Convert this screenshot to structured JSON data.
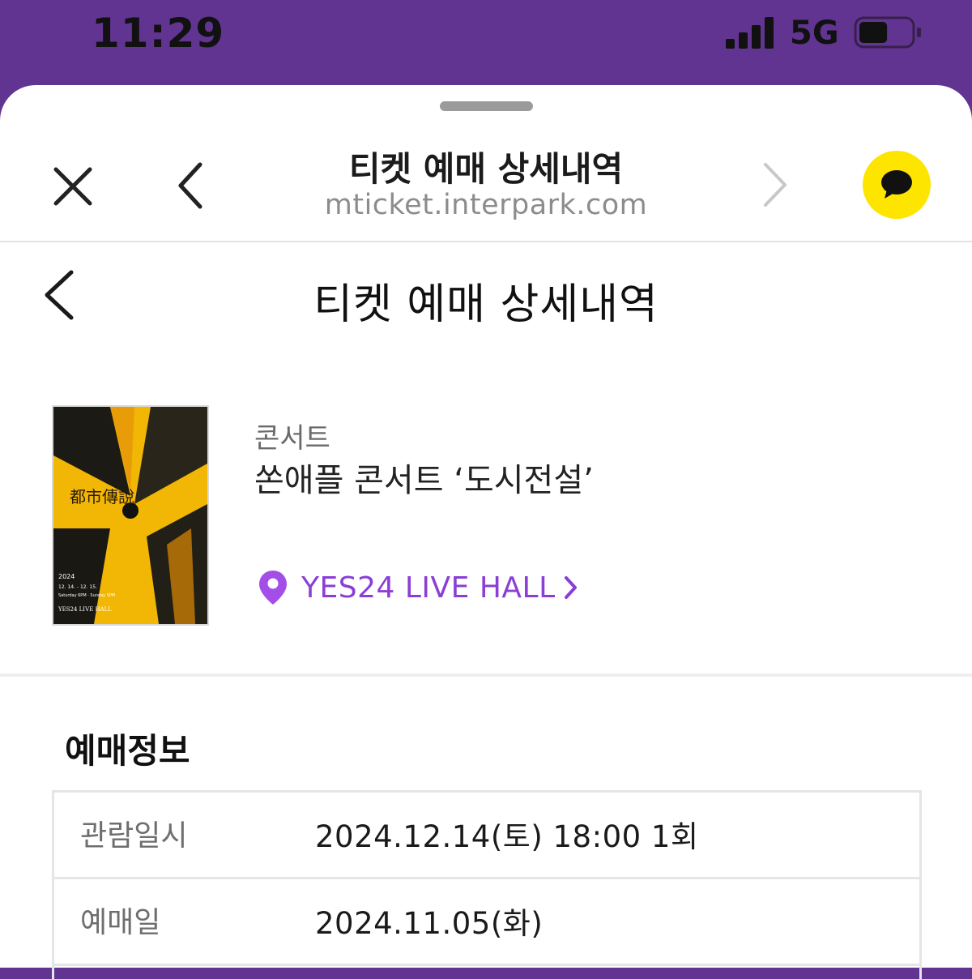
{
  "status_bar": {
    "time": "11:29",
    "network": "5G",
    "battery_level": 0.55
  },
  "webview": {
    "title": "티켓 예매 상세내역",
    "url": "mticket.interpark.com",
    "icons": {
      "close": "close-icon",
      "back": "chevron-left-icon",
      "forward": "chevron-right-icon",
      "chat": "kakao-chat-icon"
    }
  },
  "page": {
    "title": "티켓 예매 상세내역"
  },
  "performance": {
    "genre": "콘서트",
    "title": "쏜애플 콘서트 ‘도시전설’",
    "venue": "YES24 LIVE HALL",
    "poster": {
      "title_cn": "都市傳說",
      "year": "2024",
      "dates": "12. 14. - 12. 15.",
      "times": "Saturday 6PM · Sunday 5PM",
      "venue": "YES24 LIVE HALL"
    }
  },
  "booking_info": {
    "section_title": "예매정보",
    "rows": [
      {
        "label": "관람일시",
        "value": "2024.12.14(토) 18:00 1회"
      },
      {
        "label": "예매일",
        "value": "2024.11.05(화)"
      }
    ]
  },
  "colors": {
    "status_bar": "#623492",
    "venue_accent": "#8a3ed6",
    "kakao": "#fee500"
  }
}
